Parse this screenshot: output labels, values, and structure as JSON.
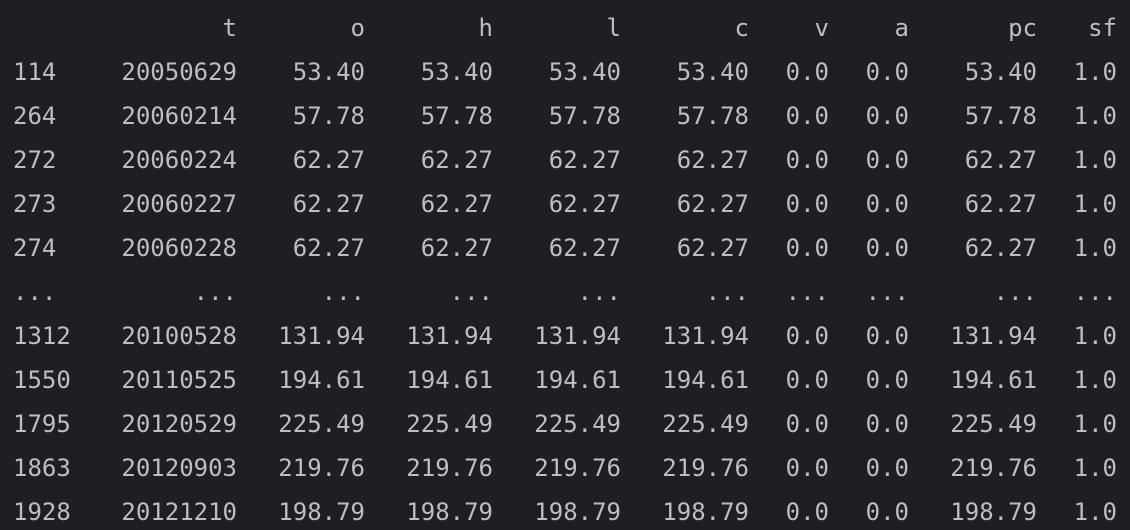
{
  "dataframe": {
    "columns": [
      "t",
      "o",
      "h",
      "l",
      "c",
      "v",
      "a",
      "pc",
      "sf"
    ],
    "rows": [
      {
        "index": "114",
        "values": [
          "20050629",
          "53.40",
          "53.40",
          "53.40",
          "53.40",
          "0.0",
          "0.0",
          "53.40",
          "1.0"
        ]
      },
      {
        "index": "264",
        "values": [
          "20060214",
          "57.78",
          "57.78",
          "57.78",
          "57.78",
          "0.0",
          "0.0",
          "57.78",
          "1.0"
        ]
      },
      {
        "index": "272",
        "values": [
          "20060224",
          "62.27",
          "62.27",
          "62.27",
          "62.27",
          "0.0",
          "0.0",
          "62.27",
          "1.0"
        ]
      },
      {
        "index": "273",
        "values": [
          "20060227",
          "62.27",
          "62.27",
          "62.27",
          "62.27",
          "0.0",
          "0.0",
          "62.27",
          "1.0"
        ]
      },
      {
        "index": "274",
        "values": [
          "20060228",
          "62.27",
          "62.27",
          "62.27",
          "62.27",
          "0.0",
          "0.0",
          "62.27",
          "1.0"
        ]
      },
      {
        "index": "...",
        "values": [
          "...",
          "...",
          "...",
          "...",
          "...",
          "...",
          "...",
          "...",
          "..."
        ]
      },
      {
        "index": "1312",
        "values": [
          "20100528",
          "131.94",
          "131.94",
          "131.94",
          "131.94",
          "0.0",
          "0.0",
          "131.94",
          "1.0"
        ]
      },
      {
        "index": "1550",
        "values": [
          "20110525",
          "194.61",
          "194.61",
          "194.61",
          "194.61",
          "0.0",
          "0.0",
          "194.61",
          "1.0"
        ]
      },
      {
        "index": "1795",
        "values": [
          "20120529",
          "225.49",
          "225.49",
          "225.49",
          "225.49",
          "0.0",
          "0.0",
          "225.49",
          "1.0"
        ]
      },
      {
        "index": "1863",
        "values": [
          "20120903",
          "219.76",
          "219.76",
          "219.76",
          "219.76",
          "0.0",
          "0.0",
          "219.76",
          "1.0"
        ]
      },
      {
        "index": "1928",
        "values": [
          "20121210",
          "198.79",
          "198.79",
          "198.79",
          "198.79",
          "0.0",
          "0.0",
          "198.79",
          "1.0"
        ]
      }
    ]
  },
  "colors": {
    "background": "#1e1f22",
    "text": "#bcbec4"
  }
}
